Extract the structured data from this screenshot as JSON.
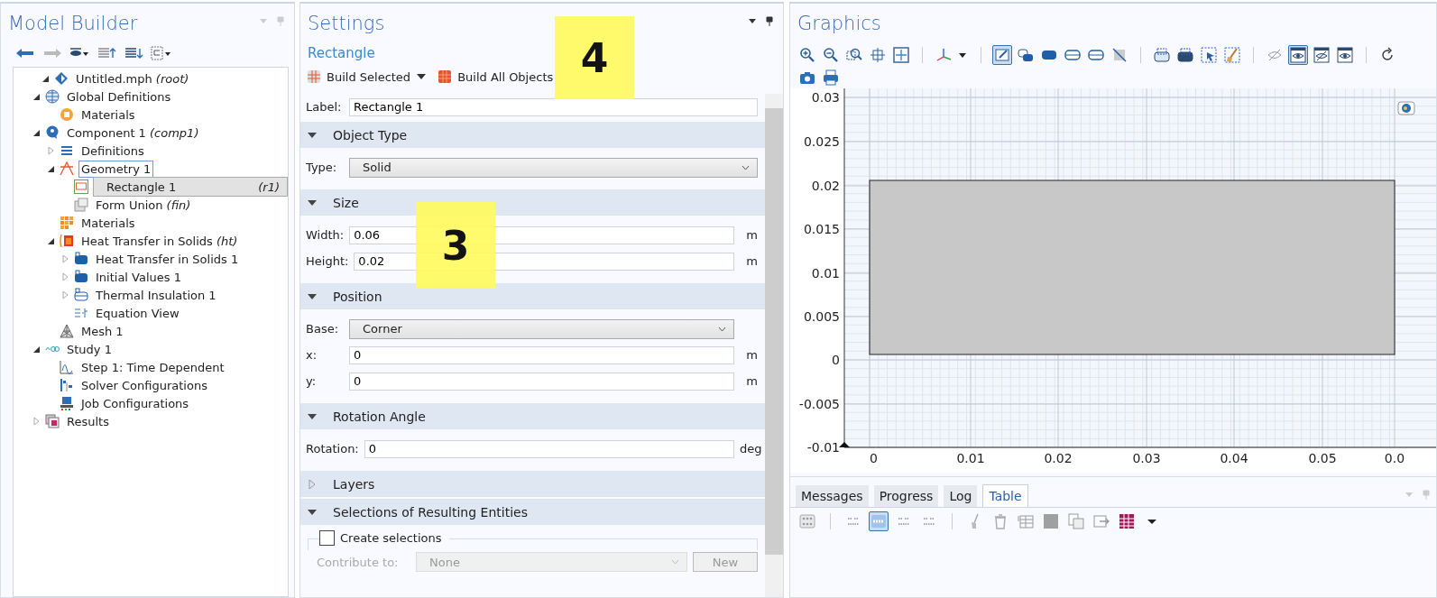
{
  "model_builder": {
    "title": "Model Builder",
    "toolbar": [
      {
        "kind": "back"
      },
      {
        "kind": "forward"
      },
      {
        "kind": "eye-menu"
      },
      {
        "kind": "collapse"
      },
      {
        "kind": "expand"
      },
      {
        "kind": "tree-menu"
      }
    ],
    "tree": [
      {
        "label": "Untitled.mph *(root)*",
        "kind": "model",
        "expanded": true,
        "selected": false,
        "focused": false,
        "children": [
          {
            "label": "Global Definitions",
            "kind": "globe",
            "expanded": true,
            "selected": false,
            "focused": false,
            "children": [
              {
                "label": "Materials",
                "kind": "material",
                "selected": false,
                "focused": false
              }
            ]
          },
          {
            "label": "Component 1 *(comp1)*",
            "kind": "component",
            "expanded": true,
            "selected": false,
            "focused": false,
            "children": [
              {
                "label": "Definitions",
                "kind": "list",
                "expanded": false,
                "selected": false,
                "focused": false
              },
              {
                "label": "Geometry 1",
                "kind": "geometry",
                "expanded": true,
                "selected": false,
                "focused": true,
                "children": [
                  {
                    "label": "Rectangle 1 *(r1)*",
                    "kind": "rectangle",
                    "selected": true,
                    "focused": false
                  },
                  {
                    "label": "Form Union *(fin)*",
                    "kind": "union",
                    "selected": false,
                    "focused": false
                  }
                ]
              },
              {
                "label": "Materials",
                "kind": "materials",
                "selected": false,
                "focused": false
              },
              {
                "label": "Heat Transfer in Solids *(ht)*",
                "kind": "heat",
                "expanded": true,
                "selected": false,
                "focused": false,
                "children": [
                  {
                    "label": "Heat Transfer in Solids 1",
                    "kind": "domain",
                    "expanded": false,
                    "selected": false,
                    "focused": false
                  },
                  {
                    "label": "Initial Values 1",
                    "kind": "domain",
                    "expanded": false,
                    "selected": false,
                    "focused": false
                  },
                  {
                    "label": "Thermal Insulation 1",
                    "kind": "boundary",
                    "expanded": false,
                    "selected": false,
                    "focused": false
                  },
                  {
                    "label": "Equation View",
                    "kind": "equation",
                    "selected": false,
                    "focused": false
                  }
                ]
              },
              {
                "label": "Mesh 1",
                "kind": "mesh",
                "selected": false,
                "focused": false
              }
            ]
          },
          {
            "label": "Study 1",
            "kind": "study",
            "expanded": true,
            "selected": false,
            "focused": false,
            "children": [
              {
                "label": "Step 1: Time Dependent",
                "kind": "step",
                "selected": false,
                "focused": false
              },
              {
                "label": "Solver Configurations",
                "kind": "solver",
                "selected": false,
                "focused": false
              },
              {
                "label": "Job Configurations",
                "kind": "job",
                "selected": false,
                "focused": false
              }
            ]
          },
          {
            "label": "Results",
            "kind": "results",
            "expanded": false,
            "selected": false,
            "focused": false
          }
        ]
      }
    ]
  },
  "settings": {
    "title": "Settings",
    "subtitle": "Rectangle",
    "toolbar": [
      {
        "label": "Build Selected",
        "has_menu": true
      },
      {
        "label": "Build All Objects",
        "has_menu": false
      }
    ],
    "label_field": {
      "label": "Label:",
      "value": "Rectangle 1"
    },
    "sections": [
      {
        "title": "Object Type",
        "expanded": true,
        "rows": [
          {
            "kind": "select",
            "label": "Type:",
            "value": "Solid"
          }
        ]
      },
      {
        "title": "Size",
        "expanded": true,
        "rows": [
          {
            "kind": "input",
            "label": "Width:",
            "value": "0.06",
            "unit": "m"
          },
          {
            "kind": "input",
            "label": "Height:",
            "value": "0.02",
            "unit": "m"
          }
        ]
      },
      {
        "title": "Position",
        "expanded": true,
        "rows": [
          {
            "kind": "select",
            "label": "Base:",
            "value": "Corner"
          },
          {
            "kind": "input",
            "label": "x:",
            "value": "0",
            "unit": "m"
          },
          {
            "kind": "input",
            "label": "y:",
            "value": "0",
            "unit": "m"
          }
        ]
      },
      {
        "title": "Rotation Angle",
        "expanded": true,
        "rows": [
          {
            "kind": "input",
            "label": "Rotation:",
            "value": "0",
            "unit": "deg"
          }
        ]
      },
      {
        "title": "Layers",
        "expanded": false
      },
      {
        "title": "Selections of Resulting Entities",
        "expanded": true,
        "rows": [
          {
            "kind": "checkbox",
            "label": "Create selections",
            "checked": false
          },
          {
            "kind": "select-button",
            "label": "Contribute to:",
            "value": "None",
            "button": "New",
            "disabled": true
          }
        ]
      }
    ]
  },
  "callouts": [
    {
      "text": "4"
    },
    {
      "text": "3"
    }
  ],
  "graphics": {
    "title": "Graphics",
    "toolbar": [
      [
        [
          {
            "kind": "zoom-in",
            "selected": false
          },
          {
            "kind": "zoom-out",
            "selected": false
          },
          {
            "kind": "zoom-box",
            "selected": false
          },
          {
            "kind": "center",
            "selected": false
          },
          {
            "kind": "zoom-extents",
            "selected": false
          }
        ],
        [
          {
            "kind": "axes-menu",
            "selected": false
          }
        ],
        [
          {
            "kind": "wireframe",
            "selected": true
          },
          {
            "kind": "transparency",
            "selected": false
          },
          {
            "kind": "solid",
            "selected": false
          },
          {
            "kind": "render",
            "selected": false
          },
          {
            "kind": "render",
            "selected": false
          },
          {
            "kind": "hide-mesh",
            "selected": false
          }
        ],
        [
          {
            "kind": "select-box",
            "selected": false
          },
          {
            "kind": "select-box-dark",
            "selected": false
          },
          {
            "kind": "select-pointer",
            "selected": false
          },
          {
            "kind": "clear-selection",
            "selected": false
          }
        ],
        [
          {
            "kind": "hide",
            "selected": false
          },
          {
            "kind": "eye",
            "selected": true
          },
          {
            "kind": "eye-hide",
            "selected": false
          },
          {
            "kind": "eye",
            "selected": false
          }
        ],
        [
          {
            "kind": "reset",
            "selected": false
          }
        ]
      ],
      [
        [
          {
            "kind": "camera",
            "selected": false
          },
          {
            "kind": "print",
            "selected": false
          }
        ]
      ]
    ],
    "x_ticks": [
      "0",
      "0.01",
      "0.02",
      "0.03",
      "0.04",
      "0.05",
      "0.0"
    ],
    "y_ticks": [
      "0.03",
      "0.025",
      "0.02",
      "0.015",
      "0.01",
      "0.005",
      "0",
      "-0.005",
      "-0.01"
    ],
    "tabs": [
      {
        "label": "Messages",
        "selected": false
      },
      {
        "label": "Progress",
        "selected": false
      },
      {
        "label": "Log",
        "selected": false
      },
      {
        "label": "Table",
        "selected": true
      }
    ],
    "table_toolbar": [
      [
        {
          "kind": "table-settings",
          "selected": false
        }
      ],
      [
        {
          "kind": "format-sci",
          "selected": false
        },
        {
          "kind": "format-auto",
          "selected": true
        },
        {
          "kind": "format-e",
          "selected": false
        },
        {
          "kind": "format-plain",
          "selected": false
        }
      ],
      [
        {
          "kind": "clear",
          "selected": false
        },
        {
          "kind": "delete",
          "selected": false
        },
        {
          "kind": "table-add",
          "selected": false
        },
        {
          "kind": "square",
          "selected": false
        },
        {
          "kind": "copy",
          "selected": false
        },
        {
          "kind": "export",
          "selected": false
        },
        {
          "kind": "table-color",
          "selected": false
        },
        {
          "kind": "caret",
          "selected": false
        }
      ]
    ]
  }
}
